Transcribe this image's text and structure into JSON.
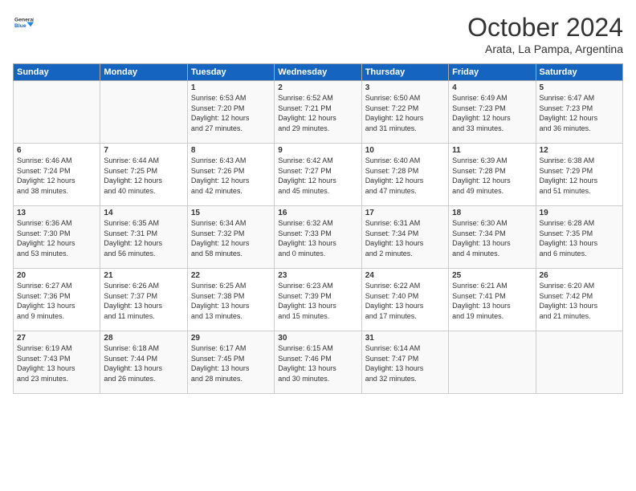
{
  "logo": {
    "general": "General",
    "blue": "Blue"
  },
  "header": {
    "month": "October 2024",
    "location": "Arata, La Pampa, Argentina"
  },
  "days_of_week": [
    "Sunday",
    "Monday",
    "Tuesday",
    "Wednesday",
    "Thursday",
    "Friday",
    "Saturday"
  ],
  "weeks": [
    [
      {
        "day": "",
        "text": ""
      },
      {
        "day": "",
        "text": ""
      },
      {
        "day": "1",
        "text": "Sunrise: 6:53 AM\nSunset: 7:20 PM\nDaylight: 12 hours\nand 27 minutes."
      },
      {
        "day": "2",
        "text": "Sunrise: 6:52 AM\nSunset: 7:21 PM\nDaylight: 12 hours\nand 29 minutes."
      },
      {
        "day": "3",
        "text": "Sunrise: 6:50 AM\nSunset: 7:22 PM\nDaylight: 12 hours\nand 31 minutes."
      },
      {
        "day": "4",
        "text": "Sunrise: 6:49 AM\nSunset: 7:23 PM\nDaylight: 12 hours\nand 33 minutes."
      },
      {
        "day": "5",
        "text": "Sunrise: 6:47 AM\nSunset: 7:23 PM\nDaylight: 12 hours\nand 36 minutes."
      }
    ],
    [
      {
        "day": "6",
        "text": "Sunrise: 6:46 AM\nSunset: 7:24 PM\nDaylight: 12 hours\nand 38 minutes."
      },
      {
        "day": "7",
        "text": "Sunrise: 6:44 AM\nSunset: 7:25 PM\nDaylight: 12 hours\nand 40 minutes."
      },
      {
        "day": "8",
        "text": "Sunrise: 6:43 AM\nSunset: 7:26 PM\nDaylight: 12 hours\nand 42 minutes."
      },
      {
        "day": "9",
        "text": "Sunrise: 6:42 AM\nSunset: 7:27 PM\nDaylight: 12 hours\nand 45 minutes."
      },
      {
        "day": "10",
        "text": "Sunrise: 6:40 AM\nSunset: 7:28 PM\nDaylight: 12 hours\nand 47 minutes."
      },
      {
        "day": "11",
        "text": "Sunrise: 6:39 AM\nSunset: 7:28 PM\nDaylight: 12 hours\nand 49 minutes."
      },
      {
        "day": "12",
        "text": "Sunrise: 6:38 AM\nSunset: 7:29 PM\nDaylight: 12 hours\nand 51 minutes."
      }
    ],
    [
      {
        "day": "13",
        "text": "Sunrise: 6:36 AM\nSunset: 7:30 PM\nDaylight: 12 hours\nand 53 minutes."
      },
      {
        "day": "14",
        "text": "Sunrise: 6:35 AM\nSunset: 7:31 PM\nDaylight: 12 hours\nand 56 minutes."
      },
      {
        "day": "15",
        "text": "Sunrise: 6:34 AM\nSunset: 7:32 PM\nDaylight: 12 hours\nand 58 minutes."
      },
      {
        "day": "16",
        "text": "Sunrise: 6:32 AM\nSunset: 7:33 PM\nDaylight: 13 hours\nand 0 minutes."
      },
      {
        "day": "17",
        "text": "Sunrise: 6:31 AM\nSunset: 7:34 PM\nDaylight: 13 hours\nand 2 minutes."
      },
      {
        "day": "18",
        "text": "Sunrise: 6:30 AM\nSunset: 7:34 PM\nDaylight: 13 hours\nand 4 minutes."
      },
      {
        "day": "19",
        "text": "Sunrise: 6:28 AM\nSunset: 7:35 PM\nDaylight: 13 hours\nand 6 minutes."
      }
    ],
    [
      {
        "day": "20",
        "text": "Sunrise: 6:27 AM\nSunset: 7:36 PM\nDaylight: 13 hours\nand 9 minutes."
      },
      {
        "day": "21",
        "text": "Sunrise: 6:26 AM\nSunset: 7:37 PM\nDaylight: 13 hours\nand 11 minutes."
      },
      {
        "day": "22",
        "text": "Sunrise: 6:25 AM\nSunset: 7:38 PM\nDaylight: 13 hours\nand 13 minutes."
      },
      {
        "day": "23",
        "text": "Sunrise: 6:23 AM\nSunset: 7:39 PM\nDaylight: 13 hours\nand 15 minutes."
      },
      {
        "day": "24",
        "text": "Sunrise: 6:22 AM\nSunset: 7:40 PM\nDaylight: 13 hours\nand 17 minutes."
      },
      {
        "day": "25",
        "text": "Sunrise: 6:21 AM\nSunset: 7:41 PM\nDaylight: 13 hours\nand 19 minutes."
      },
      {
        "day": "26",
        "text": "Sunrise: 6:20 AM\nSunset: 7:42 PM\nDaylight: 13 hours\nand 21 minutes."
      }
    ],
    [
      {
        "day": "27",
        "text": "Sunrise: 6:19 AM\nSunset: 7:43 PM\nDaylight: 13 hours\nand 23 minutes."
      },
      {
        "day": "28",
        "text": "Sunrise: 6:18 AM\nSunset: 7:44 PM\nDaylight: 13 hours\nand 26 minutes."
      },
      {
        "day": "29",
        "text": "Sunrise: 6:17 AM\nSunset: 7:45 PM\nDaylight: 13 hours\nand 28 minutes."
      },
      {
        "day": "30",
        "text": "Sunrise: 6:15 AM\nSunset: 7:46 PM\nDaylight: 13 hours\nand 30 minutes."
      },
      {
        "day": "31",
        "text": "Sunrise: 6:14 AM\nSunset: 7:47 PM\nDaylight: 13 hours\nand 32 minutes."
      },
      {
        "day": "",
        "text": ""
      },
      {
        "day": "",
        "text": ""
      }
    ]
  ]
}
